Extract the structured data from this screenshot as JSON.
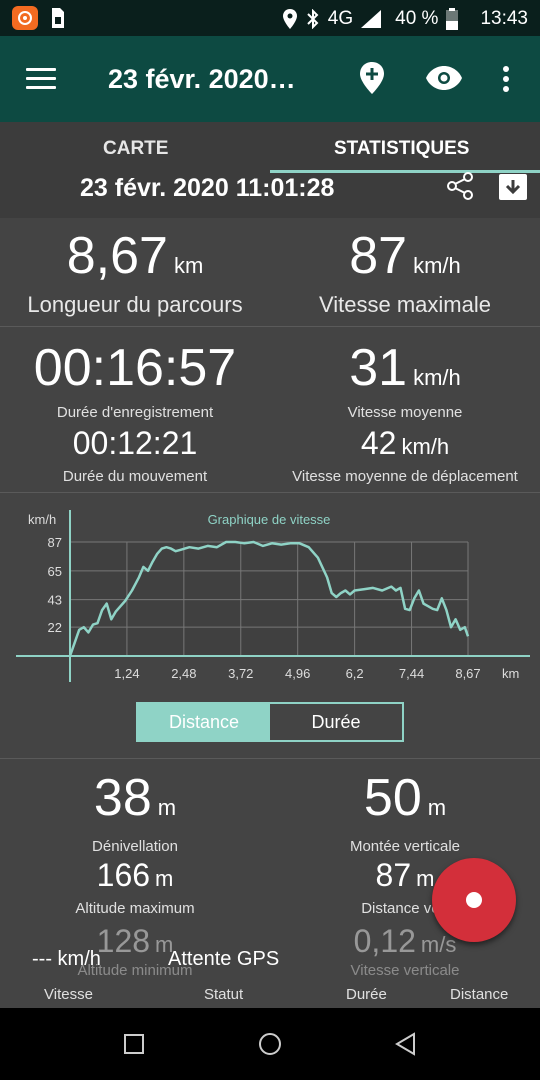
{
  "status_bar": {
    "battery_percent": "40 %",
    "time": "13:43",
    "network": "4G",
    "icons": [
      "app-badge-icon",
      "sim-card-icon",
      "location-icon",
      "bluetooth-icon",
      "signal-icon",
      "battery-icon"
    ]
  },
  "toolbar": {
    "title": "23 févr. 2020…",
    "icons": [
      "menu-icon",
      "add-location-icon",
      "eye-icon",
      "more-vert-icon"
    ]
  },
  "tabs": {
    "carte": "CARTE",
    "statistiques": "STATISTIQUES",
    "selected": "STATISTIQUES"
  },
  "track_date": "23 févr. 2020 11:01:28",
  "summary": {
    "distance": {
      "value": "8,67",
      "unit": "km",
      "label": "Longueur du parcours"
    },
    "max_speed": {
      "value": "87",
      "unit": "km/h",
      "label": "Vitesse maximale"
    }
  },
  "timing": {
    "rec_duration": {
      "value": "00:16:57",
      "label": "Durée d'enregistrement"
    },
    "avg_speed": {
      "value": "31",
      "unit": "km/h",
      "label": "Vitesse moyenne"
    },
    "move_duration": {
      "value": "00:12:21",
      "label": "Durée du mouvement"
    },
    "avg_move_speed": {
      "value": "42",
      "unit": "km/h",
      "label": "Vitesse moyenne de déplacement"
    }
  },
  "chart_data": {
    "type": "line",
    "title": "Graphique de vitesse",
    "ylabel": "km/h",
    "xlabel": "km",
    "y_ticks": [
      "87",
      "65",
      "43",
      "22"
    ],
    "x_ticks": [
      "1,24",
      "2,48",
      "3,72",
      "4,96",
      "6,2",
      "7,44",
      "8,67"
    ],
    "xlim": [
      0,
      8.67
    ],
    "ylim": [
      0,
      87
    ],
    "grid": true,
    "line_color": "#8fd3c6",
    "series": [
      {
        "x": [
          0,
          0.1,
          0.2,
          0.3,
          0.4,
          0.5,
          0.6,
          0.7,
          0.8,
          0.9,
          1.0,
          1.1,
          1.2,
          1.35,
          1.5,
          1.6,
          1.7,
          1.8,
          1.9,
          2.0,
          2.1,
          2.2,
          2.3,
          2.4,
          2.6,
          2.8,
          3.0,
          3.2,
          3.4,
          3.6,
          3.8,
          4.0,
          4.2,
          4.4,
          4.6,
          4.8,
          5.0,
          5.2,
          5.4,
          5.6,
          5.7,
          5.8,
          5.9,
          6.0,
          6.1,
          6.2,
          6.4,
          6.6,
          6.8,
          7.0,
          7.1,
          7.2,
          7.3,
          7.4,
          7.5,
          7.6,
          7.7,
          7.8,
          7.9,
          8.0,
          8.1,
          8.2,
          8.3,
          8.4,
          8.5,
          8.6,
          8.67
        ],
        "y": [
          0,
          10,
          20,
          22,
          18,
          24,
          25,
          35,
          40,
          28,
          34,
          38,
          42,
          50,
          60,
          68,
          65,
          72,
          78,
          82,
          83,
          82,
          80,
          81,
          83,
          82,
          84,
          83,
          87,
          87,
          86,
          87,
          84,
          86,
          85,
          86,
          86,
          83,
          75,
          60,
          48,
          45,
          48,
          50,
          47,
          50,
          51,
          52,
          50,
          53,
          50,
          52,
          36,
          35,
          44,
          50,
          40,
          38,
          36,
          35,
          44,
          35,
          22,
          28,
          20,
          22,
          15
        ]
      }
    ]
  },
  "segmented": {
    "distance": "Distance",
    "duree": "Durée",
    "selected": "Distance"
  },
  "elevation": {
    "denivellation": {
      "value": "38",
      "unit": "m",
      "label": "Dénivellation"
    },
    "montee": {
      "value": "50",
      "unit": "m",
      "label": "Montée verticale"
    },
    "alt_max": {
      "value": "166",
      "unit": "m",
      "label": "Altitude maximum"
    },
    "dist_vert": {
      "value": "87",
      "unit": "m",
      "label": "Distance vert"
    },
    "alt_min": {
      "value": "128",
      "unit": "m",
      "label": "Altitude minimum"
    },
    "vit_vert": {
      "value": "0,12",
      "unit": "m/s",
      "label": "Vitesse verticale"
    }
  },
  "live_bar": {
    "speed": "--- km/h",
    "status": "Attente GPS",
    "labels": {
      "vitesse": "Vitesse",
      "statut": "Statut",
      "duree": "Durée",
      "distance": "Distance"
    }
  },
  "colors": {
    "toolbar": "#0d4a42",
    "accent": "#8fd3c6",
    "fab": "#d32f3a",
    "app_badge": "#f26b21"
  }
}
